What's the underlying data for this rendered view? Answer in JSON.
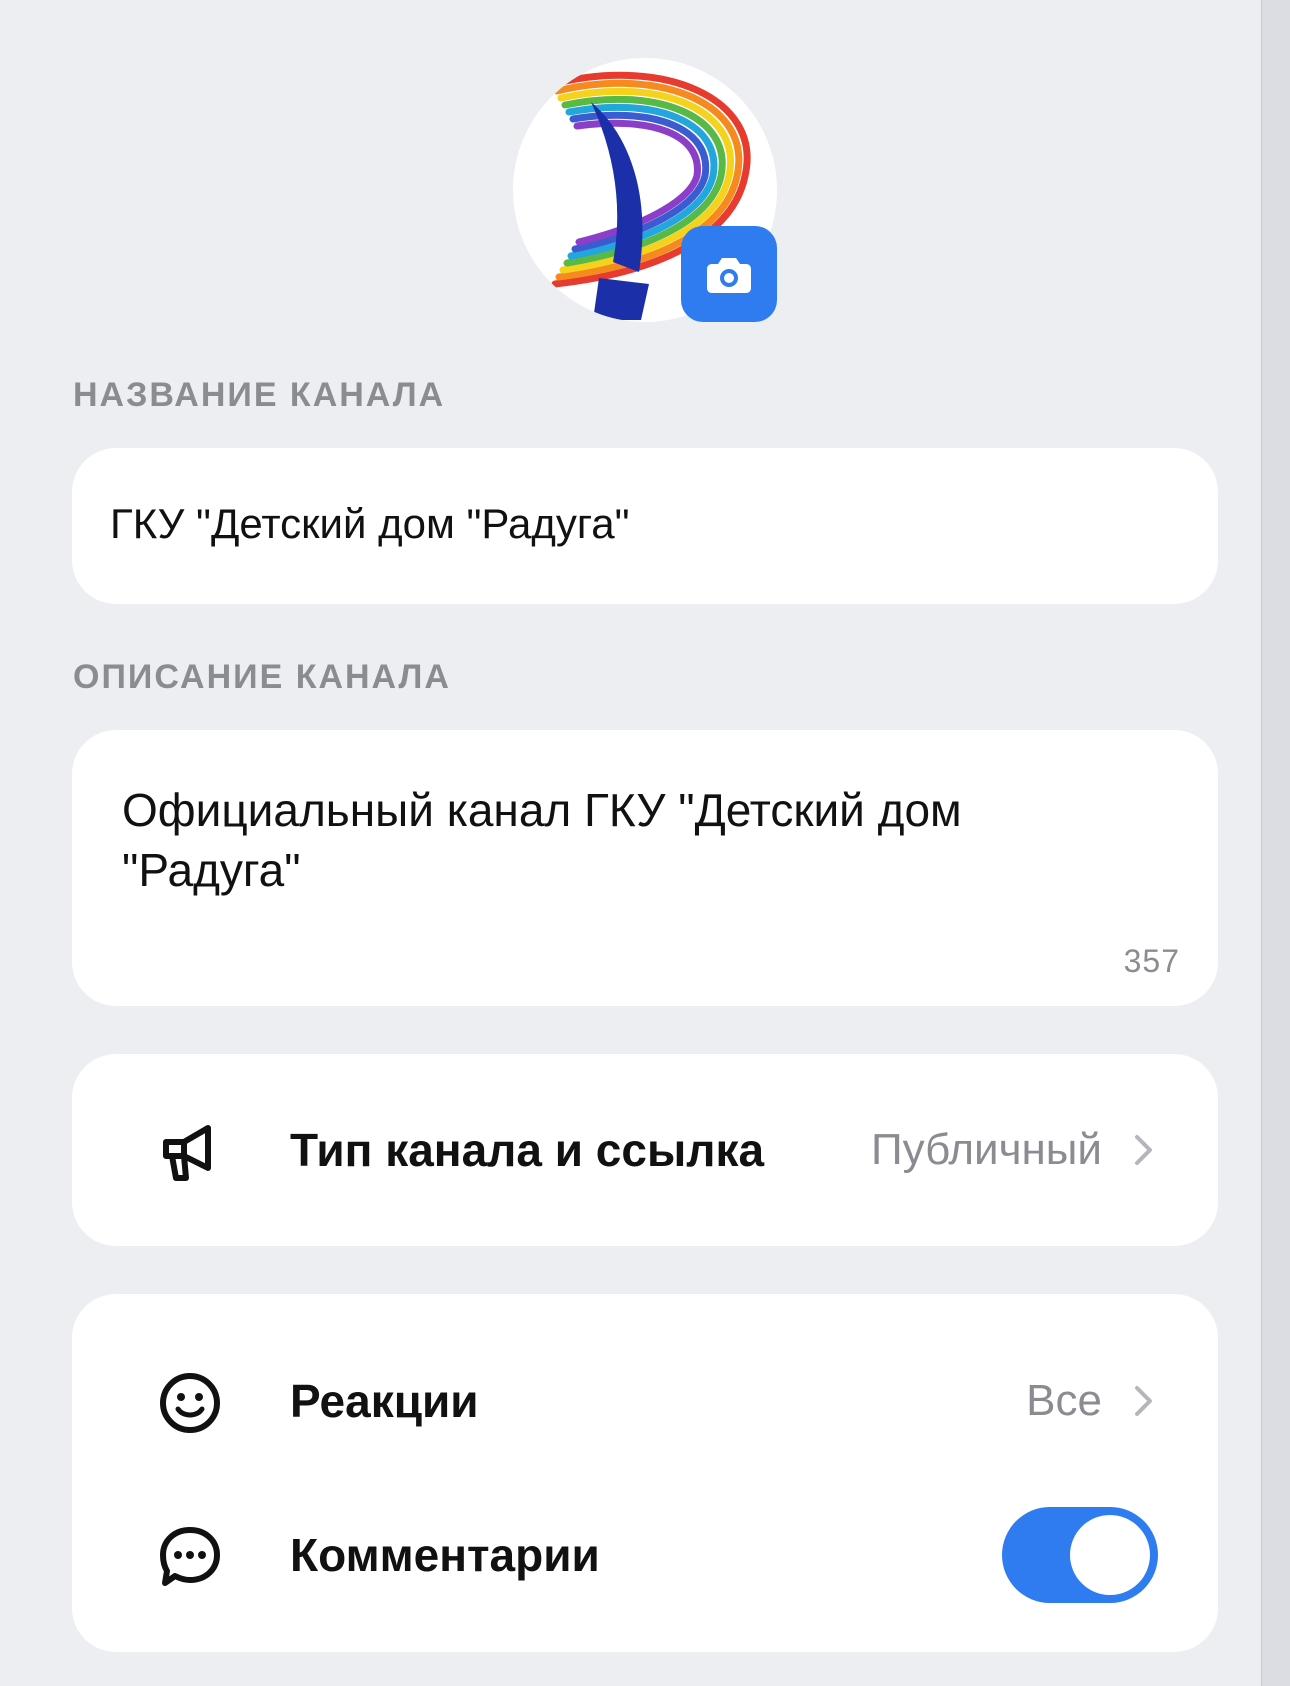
{
  "channel": {
    "name_label": "НАЗВАНИЕ КАНАЛА",
    "name_value": "ГКУ \"Детский дом \"Радуга\"",
    "description_label": "ОПИСАНИЕ КАНАЛА",
    "description_value": "Официальный канал ГКУ \"Детский дом \"Радуга\"",
    "description_counter": "357"
  },
  "settings": {
    "type_link": {
      "label": "Тип канала и ссылка",
      "value": "Публичный",
      "icon": "megaphone-icon"
    },
    "reactions": {
      "label": "Реакции",
      "value": "Все",
      "icon": "smile-icon"
    },
    "comments": {
      "label": "Комментарии",
      "enabled": true,
      "icon": "chat-bubble-icon"
    }
  },
  "colors": {
    "accent": "#2f7cf0",
    "background": "#eceef2",
    "secondary_text": "#8a8c92"
  }
}
